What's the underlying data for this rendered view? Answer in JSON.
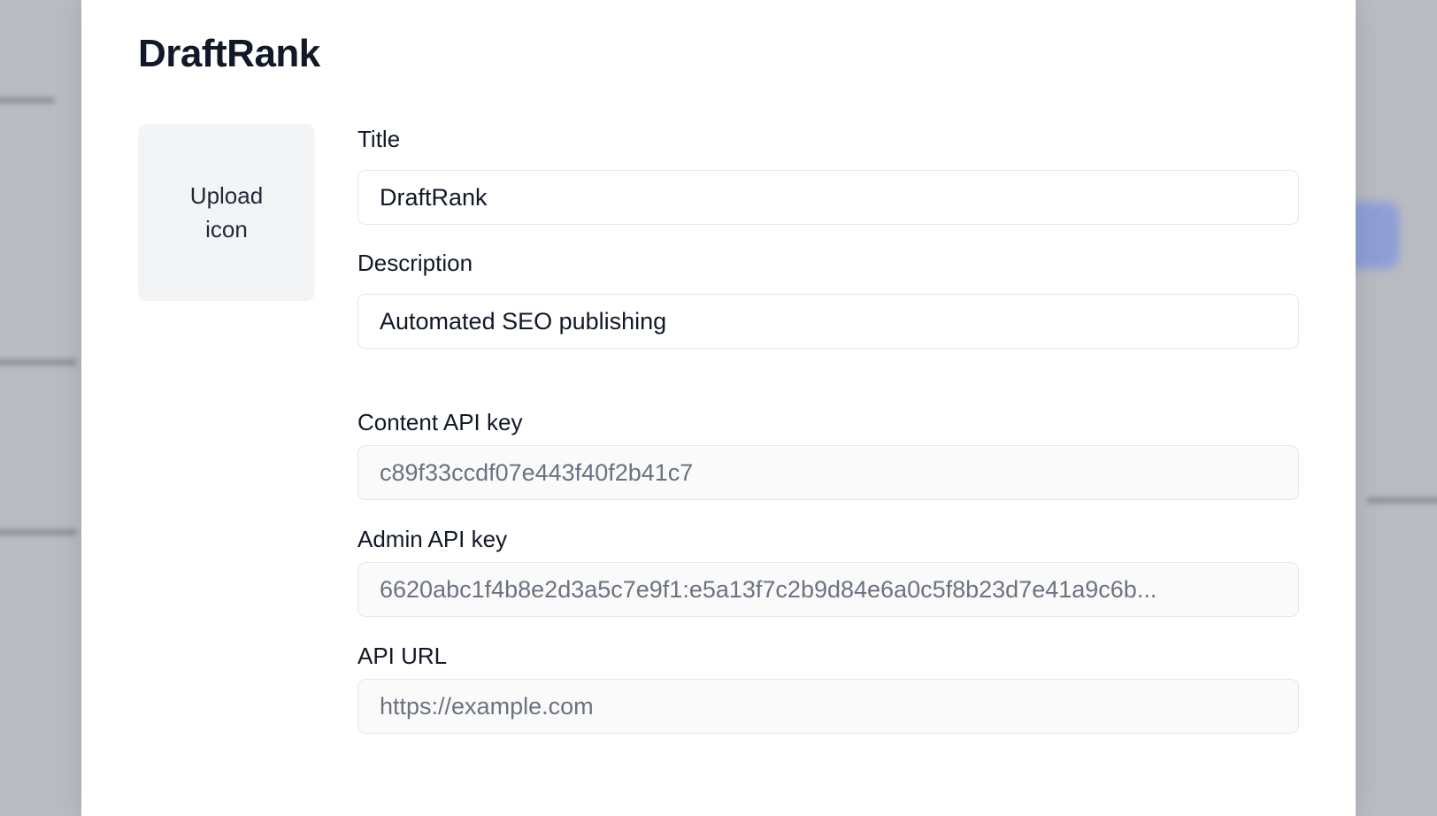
{
  "dialog": {
    "title": "DraftRank"
  },
  "upload": {
    "label": "Upload icon"
  },
  "fields": {
    "title": {
      "label": "Title",
      "value": "DraftRank"
    },
    "description": {
      "label": "Description",
      "value": "Automated SEO publishing"
    },
    "content_api_key": {
      "label": "Content API key",
      "value": "c89f33ccdf07e443f40f2b41c7"
    },
    "admin_api_key": {
      "label": "Admin API key",
      "value": "6620abc1f4b8e2d3a5c7e9f1:e5a13f7c2b9d84e6a0c5f8b23d7e41a9c6b..."
    },
    "api_url": {
      "label": "API URL",
      "placeholder": "https://example.com"
    }
  },
  "colors": {
    "background_overlay": "#b9bcc1",
    "modal_background": "#ffffff",
    "upload_box": "#f3f4f6",
    "input_border": "#e5e7eb",
    "readonly_text": "#6b7280"
  }
}
